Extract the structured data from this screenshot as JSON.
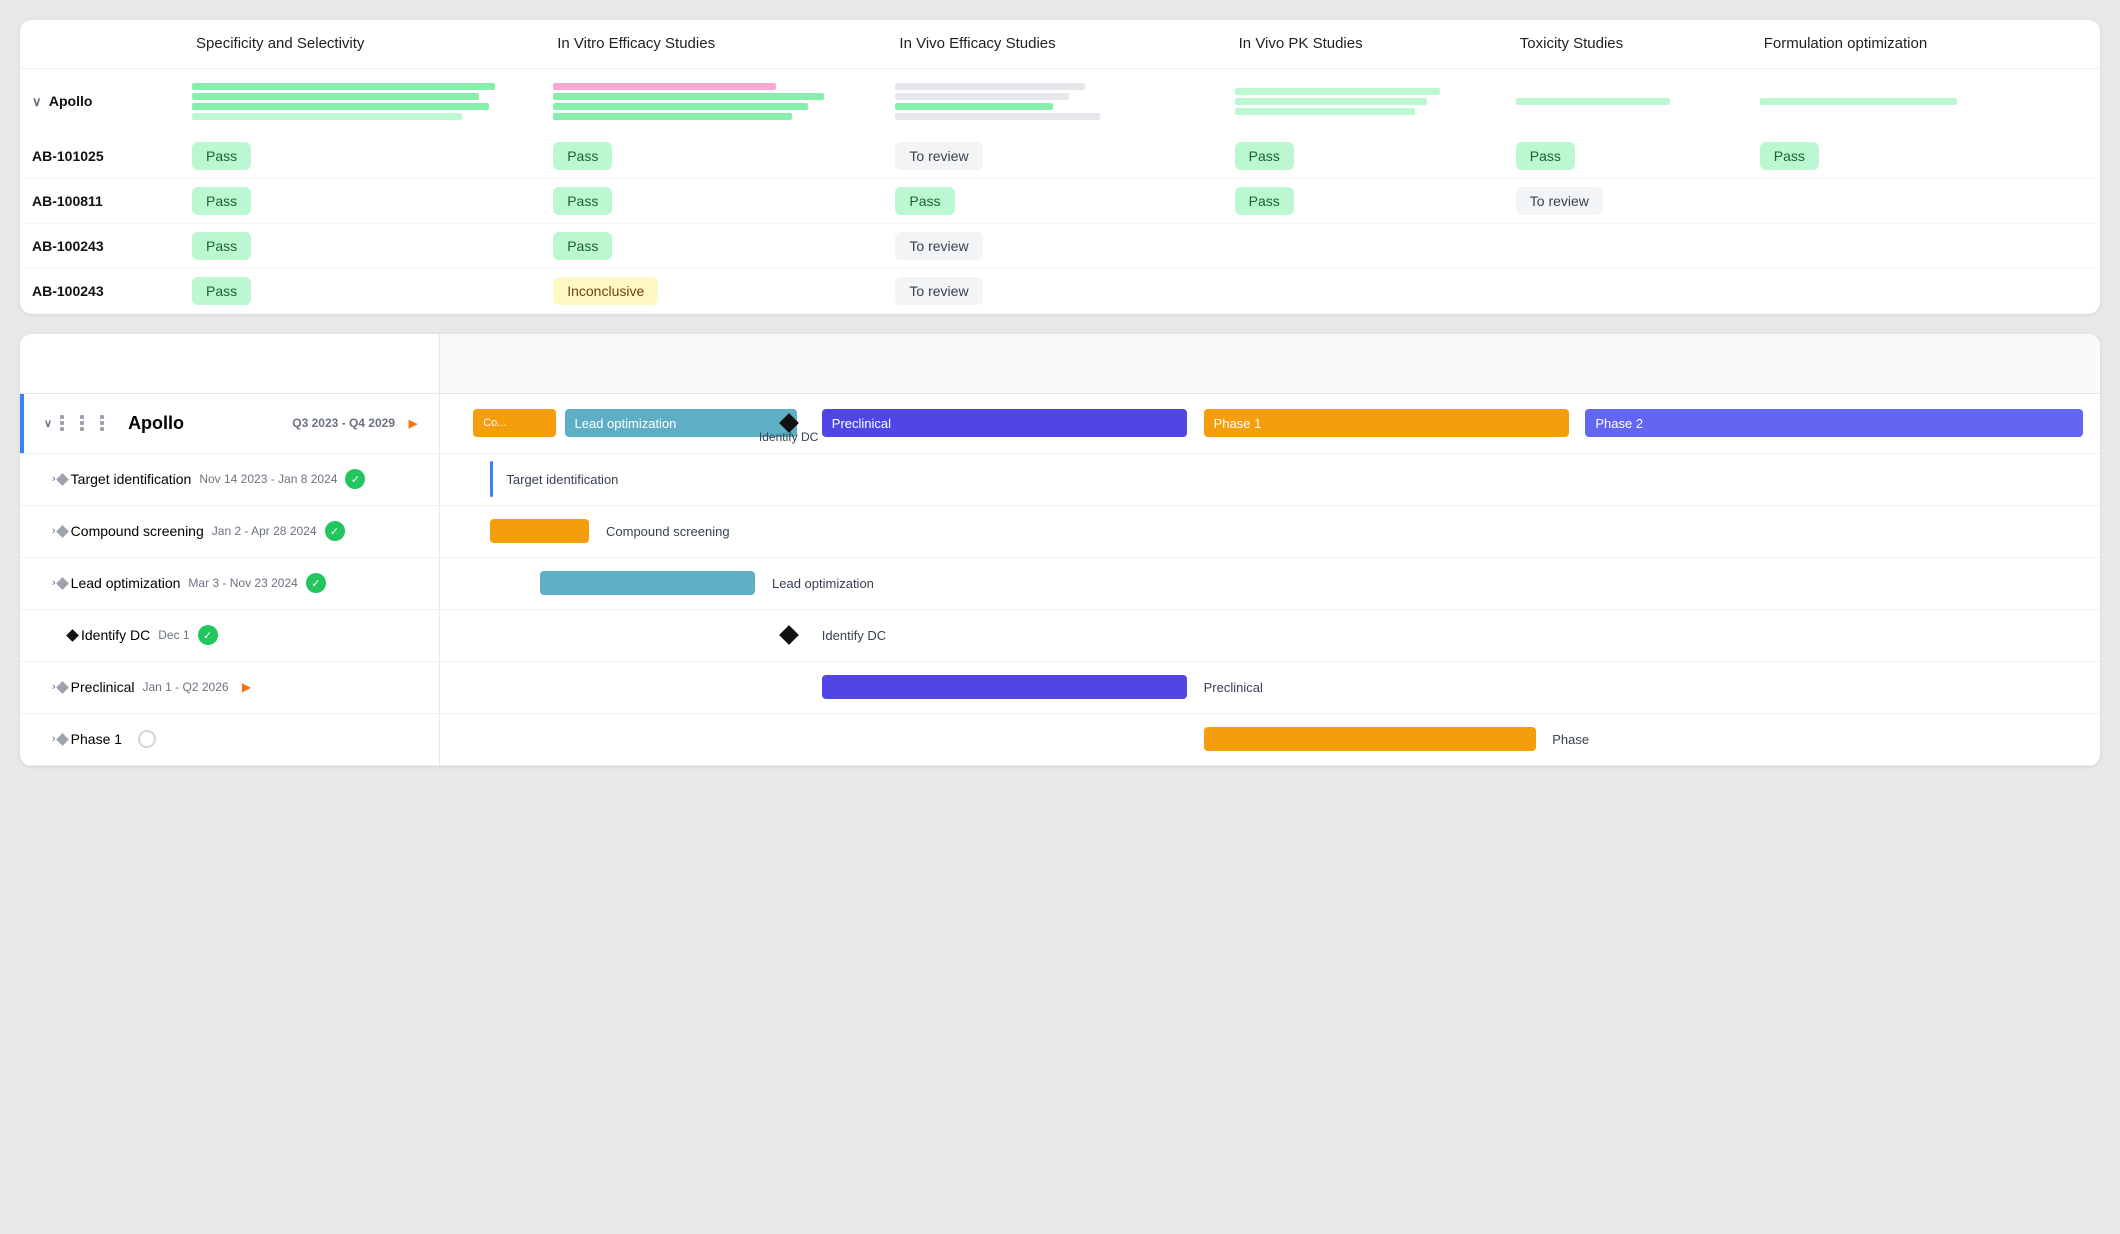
{
  "table": {
    "columns": [
      "",
      "Specificity and Selectivity",
      "In Vitro Efficacy Studies",
      "In Vivo Efficacy Studies",
      "In Vivo PK Studies",
      "Toxicity Studies",
      "Formulation optimization"
    ],
    "group": {
      "name": "Apollo",
      "expanded": true
    },
    "rows": [
      {
        "id": "AB-101025",
        "cells": [
          "Pass",
          "Pass",
          "To review",
          "Pass",
          "Pass",
          "Pass"
        ]
      },
      {
        "id": "AB-100811",
        "cells": [
          "Pass",
          "Pass",
          "Pass",
          "Pass",
          "To review",
          ""
        ]
      },
      {
        "id": "AB-100243",
        "cells": [
          "Pass",
          "Pass",
          "To review",
          "",
          "",
          ""
        ]
      },
      {
        "id": "AB-100243",
        "cells": [
          "Pass",
          "Inconclusive",
          "To review",
          "",
          "",
          ""
        ]
      }
    ]
  },
  "gantt": {
    "project_name": "Apollo",
    "date_range": "Q3 2023 - Q4 2029",
    "rows": [
      {
        "label": "Target identification",
        "dates": "Nov 14 2023 - Jan 8 2024",
        "status": "check",
        "indent": 1,
        "has_caret": true,
        "diamond_row": false
      },
      {
        "label": "Compound screening",
        "dates": "Jan 2 - Apr 28 2024",
        "status": "check",
        "indent": 1,
        "has_caret": true,
        "diamond_row": false
      },
      {
        "label": "Lead optimization",
        "dates": "Mar 3 - Nov 23 2024",
        "status": "check",
        "indent": 1,
        "has_caret": true,
        "diamond_row": false
      },
      {
        "label": "Identify DC",
        "dates": "Dec 1",
        "status": "check",
        "indent": 2,
        "has_caret": false,
        "diamond_row": true
      },
      {
        "label": "Preclinical",
        "dates": "Jan 1 - Q2 2026",
        "status": "arrow",
        "indent": 1,
        "has_caret": true,
        "diamond_row": false
      },
      {
        "label": "Phase 1",
        "dates": "",
        "status": "circle",
        "indent": 1,
        "has_caret": true,
        "diamond_row": false
      }
    ],
    "bars": {
      "main_row": [
        {
          "label": "Co...",
          "type": "compound",
          "left_pct": 0,
          "width_pct": 5
        },
        {
          "label": "Lead optimization",
          "type": "lead",
          "left_pct": 5,
          "width_pct": 16
        },
        {
          "label": "Preclinical",
          "type": "preclinical",
          "left_pct": 23,
          "width_pct": 22
        },
        {
          "label": "Phase 1",
          "type": "phase1",
          "left_pct": 47,
          "width_pct": 22
        },
        {
          "label": "Phase 2",
          "type": "phase2",
          "left_pct": 71,
          "width_pct": 29
        }
      ]
    }
  },
  "status_colors": {
    "pass": "#bbf7d0",
    "to_review": "#f3f4f6",
    "inconclusive": "#fef9c3"
  }
}
